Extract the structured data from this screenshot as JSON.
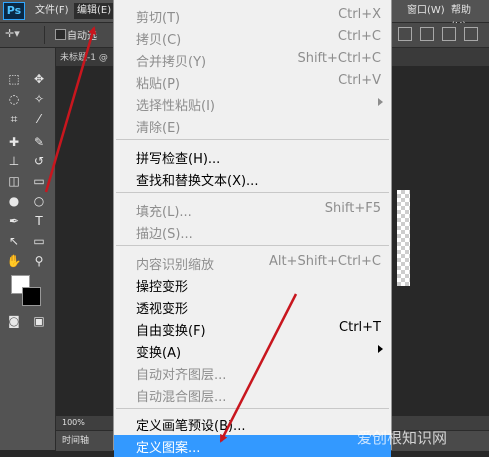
{
  "app": {
    "logo": "Ps"
  },
  "menubar": {
    "file": "文件(F)",
    "edit": "编辑(E)",
    "window": "窗口(W)",
    "help": "帮助(H)"
  },
  "options": {
    "auto_select_label": "自动选"
  },
  "document": {
    "tab_title": "未标题-1 @"
  },
  "status": {
    "zoom": "100%",
    "timeline_label": "时间轴"
  },
  "edit_menu": {
    "items": [
      {
        "label": "剪切(T)",
        "shortcut": "Ctrl+X",
        "enabled": false
      },
      {
        "label": "拷贝(C)",
        "shortcut": "Ctrl+C",
        "enabled": false
      },
      {
        "label": "合并拷贝(Y)",
        "shortcut": "Shift+Ctrl+C",
        "enabled": false
      },
      {
        "label": "粘贴(P)",
        "shortcut": "Ctrl+V",
        "enabled": false
      },
      {
        "label": "选择性粘贴(I)",
        "submenu": true,
        "enabled": false
      },
      {
        "label": "清除(E)",
        "enabled": false
      },
      {
        "label": "拼写检查(H)...",
        "enabled": true
      },
      {
        "label": "查找和替换文本(X)...",
        "enabled": true
      },
      {
        "label": "填充(L)...",
        "shortcut": "Shift+F5",
        "enabled": false
      },
      {
        "label": "描边(S)...",
        "enabled": false
      },
      {
        "label": "内容识别缩放",
        "shortcut": "Alt+Shift+Ctrl+C",
        "enabled": false
      },
      {
        "label": "操控变形",
        "enabled": true
      },
      {
        "label": "透视变形",
        "enabled": true
      },
      {
        "label": "自由变换(F)",
        "shortcut": "Ctrl+T",
        "enabled": true
      },
      {
        "label": "变换(A)",
        "submenu": true,
        "enabled": true
      },
      {
        "label": "自动对齐图层...",
        "enabled": false
      },
      {
        "label": "自动混合图层...",
        "enabled": false
      },
      {
        "label": "定义画笔预设(B)...",
        "enabled": true
      },
      {
        "label": "定义图案...",
        "enabled": true,
        "highlighted": true
      }
    ]
  },
  "watermark": "爱创根知识网",
  "colors": {
    "menu_highlight": "#3399ff",
    "annotation_arrow": "#c8161e",
    "foreground_swatch": "#ffffff",
    "background_swatch": "#000000"
  }
}
